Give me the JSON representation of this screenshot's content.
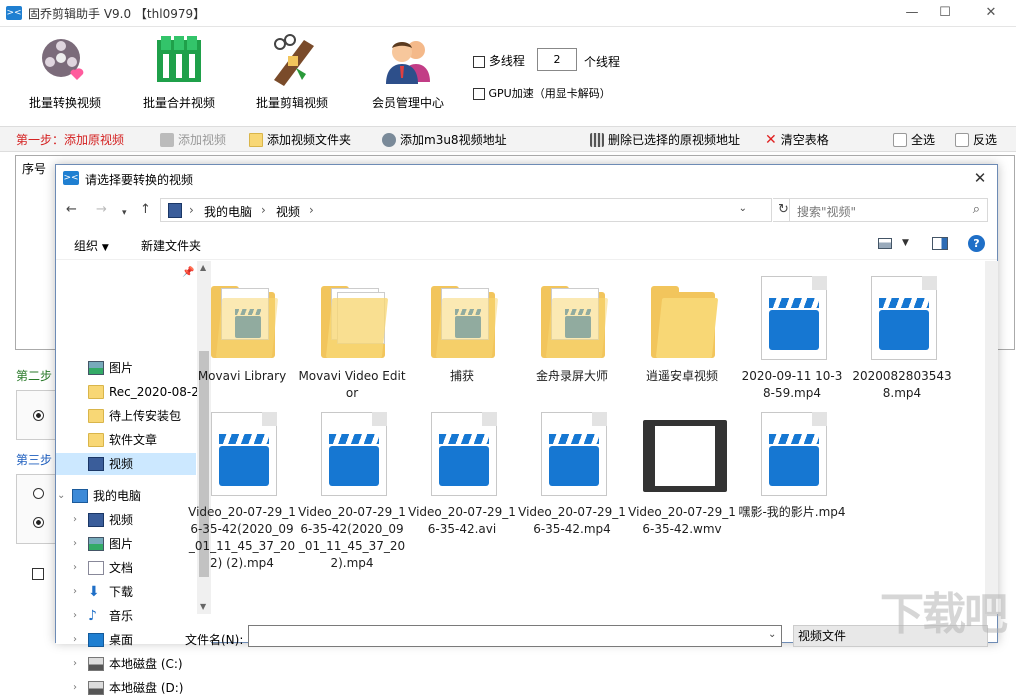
{
  "app": {
    "title": "固乔剪辑助手 V9.0 【thl0979】",
    "icon_text": "><"
  },
  "toolbar": {
    "batch_convert": "批量转换视频",
    "batch_merge": "批量合并视频",
    "batch_cut": "批量剪辑视频",
    "member_center": "会员管理中心",
    "multithread_label": "多线程",
    "thread_count": "2",
    "thread_unit": "个线程",
    "gpu_label": "GPU加速（用显卡解码）"
  },
  "step1": {
    "label": "第一步：添加原视频",
    "add_video": "添加视频",
    "add_folder": "添加视频文件夹",
    "add_m3u8": "添加m3u8视频地址",
    "delete_selected": "删除已选择的原视频地址",
    "clear_table": "清空表格",
    "select_all": "全选",
    "invert": "反选"
  },
  "table": {
    "col_seq": "序号"
  },
  "left_stub": {
    "step2": "第二步",
    "step3": "第三步"
  },
  "dialog": {
    "title": "请选择要转换的视频",
    "breadcrumb": [
      "我的电脑",
      "视频"
    ],
    "search_placeholder": "搜索\"视频\"",
    "organize": "组织",
    "new_folder": "新建文件夹",
    "nav_items": [
      {
        "label": "图片",
        "icon": "pictures-icon"
      },
      {
        "label": "Rec_2020-08-2",
        "icon": "folder-icon"
      },
      {
        "label": "待上传安装包",
        "icon": "folder-icon"
      },
      {
        "label": "软件文章",
        "icon": "folder-icon"
      },
      {
        "label": "视频",
        "icon": "videos-icon"
      },
      {
        "label": "我的电脑",
        "icon": "computer-icon"
      },
      {
        "label": "视频",
        "icon": "videos-icon"
      },
      {
        "label": "图片",
        "icon": "pictures-icon"
      },
      {
        "label": "文档",
        "icon": "documents-icon"
      },
      {
        "label": "下载",
        "icon": "download-icon"
      },
      {
        "label": "音乐",
        "icon": "music-icon"
      },
      {
        "label": "桌面",
        "icon": "desktop-icon"
      },
      {
        "label": "本地磁盘 (C:)",
        "icon": "disk-icon"
      },
      {
        "label": "本地磁盘 (D:)",
        "icon": "disk-icon"
      }
    ],
    "files_row1": [
      {
        "name": "Movavi Library",
        "kind": "folder-video"
      },
      {
        "name": "Movavi Video Editor",
        "kind": "folder-docs"
      },
      {
        "name": "捕获",
        "kind": "folder-video"
      },
      {
        "name": "金舟录屏大师",
        "kind": "folder-video"
      },
      {
        "name": "逍遥安卓视频",
        "kind": "folder-empty"
      },
      {
        "name": "2020-09-11 10-38-59.mp4",
        "kind": "video"
      },
      {
        "name": "20200828035438.mp4",
        "kind": "video"
      }
    ],
    "files_row2": [
      {
        "name": "Video_20-07-29_16-35-42(2020_09_01_11_45_37_202) (2).mp4",
        "kind": "video"
      },
      {
        "name": "Video_20-07-29_16-35-42(2020_09_01_11_45_37_202).mp4",
        "kind": "video"
      },
      {
        "name": "Video_20-07-29_16-35-42.avi",
        "kind": "video"
      },
      {
        "name": "Video_20-07-29_16-35-42.mp4",
        "kind": "video"
      },
      {
        "name": "Video_20-07-29_16-35-42.wmv",
        "kind": "film"
      },
      {
        "name": "嘿影-我的影片.mp4",
        "kind": "video"
      }
    ],
    "filename_label": "文件名(N):",
    "filename_value": "",
    "filetype": "视频文件"
  },
  "colors": {
    "step_red": "#d42020",
    "step_green": "#2a7a2a",
    "accent_blue": "#1677d2",
    "selection": "#cce8ff"
  }
}
